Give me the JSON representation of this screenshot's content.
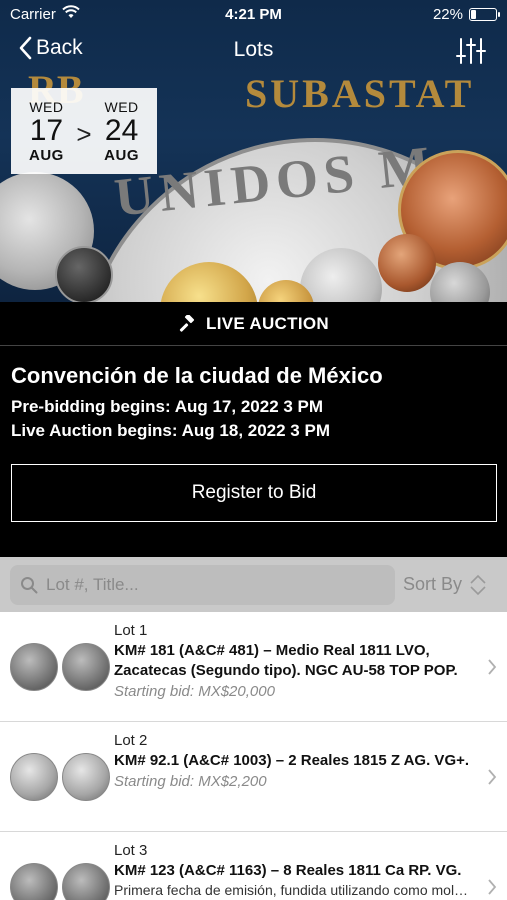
{
  "status_bar": {
    "carrier": "Carrier",
    "time": "4:21 PM",
    "battery": "22%",
    "battery_level": 0.22
  },
  "nav": {
    "back_label": "Back",
    "title": "Lots"
  },
  "hero": {
    "brand_text": "SUBASTAT",
    "brand_text_left": "RB",
    "coin_legend": "UNIDOS M"
  },
  "dates": {
    "start": {
      "dow": "WED",
      "day": "17",
      "month": "AUG"
    },
    "separator": ">",
    "end": {
      "dow": "WED",
      "day": "24",
      "month": "AUG"
    }
  },
  "live_band": {
    "label": "LIVE AUCTION"
  },
  "sale": {
    "title": "Convención de la ciudad de México",
    "prebid": "Pre-bidding begins: Aug 17, 2022 3 PM",
    "live": "Live Auction begins: Aug 18, 2022 3 PM",
    "register_label": "Register to Bid"
  },
  "search": {
    "placeholder": "Lot #, Title...",
    "sort_label": "Sort By"
  },
  "lots": [
    {
      "number": "Lot 1",
      "title": "KM# 181 (A&C# 481) – Medio Real 1811 LVO, Zacatecas (Segundo tipo). NGC AU-58 TOP POP.",
      "desc": "",
      "bid": "Starting bid: MX$20,000"
    },
    {
      "number": "Lot 2",
      "title": "KM# 92.1 (A&C# 1003) – 2 Reales 1815 Z AG. VG+.",
      "desc": "",
      "bid": "Starting bid: MX$2,200"
    },
    {
      "number": "Lot 3",
      "title": "KM# 123 (A&C# 1163) – 8 Reales 1811 Ca RP. VG.",
      "desc": "Primera fecha de emisión, fundida utilizando como mol…",
      "bid": ""
    }
  ],
  "colors": {
    "hero_bg": "#143357",
    "brand_gold": "#b48a3c",
    "search_bg": "#c9c9c9",
    "bid_text": "#8a8a8a"
  }
}
